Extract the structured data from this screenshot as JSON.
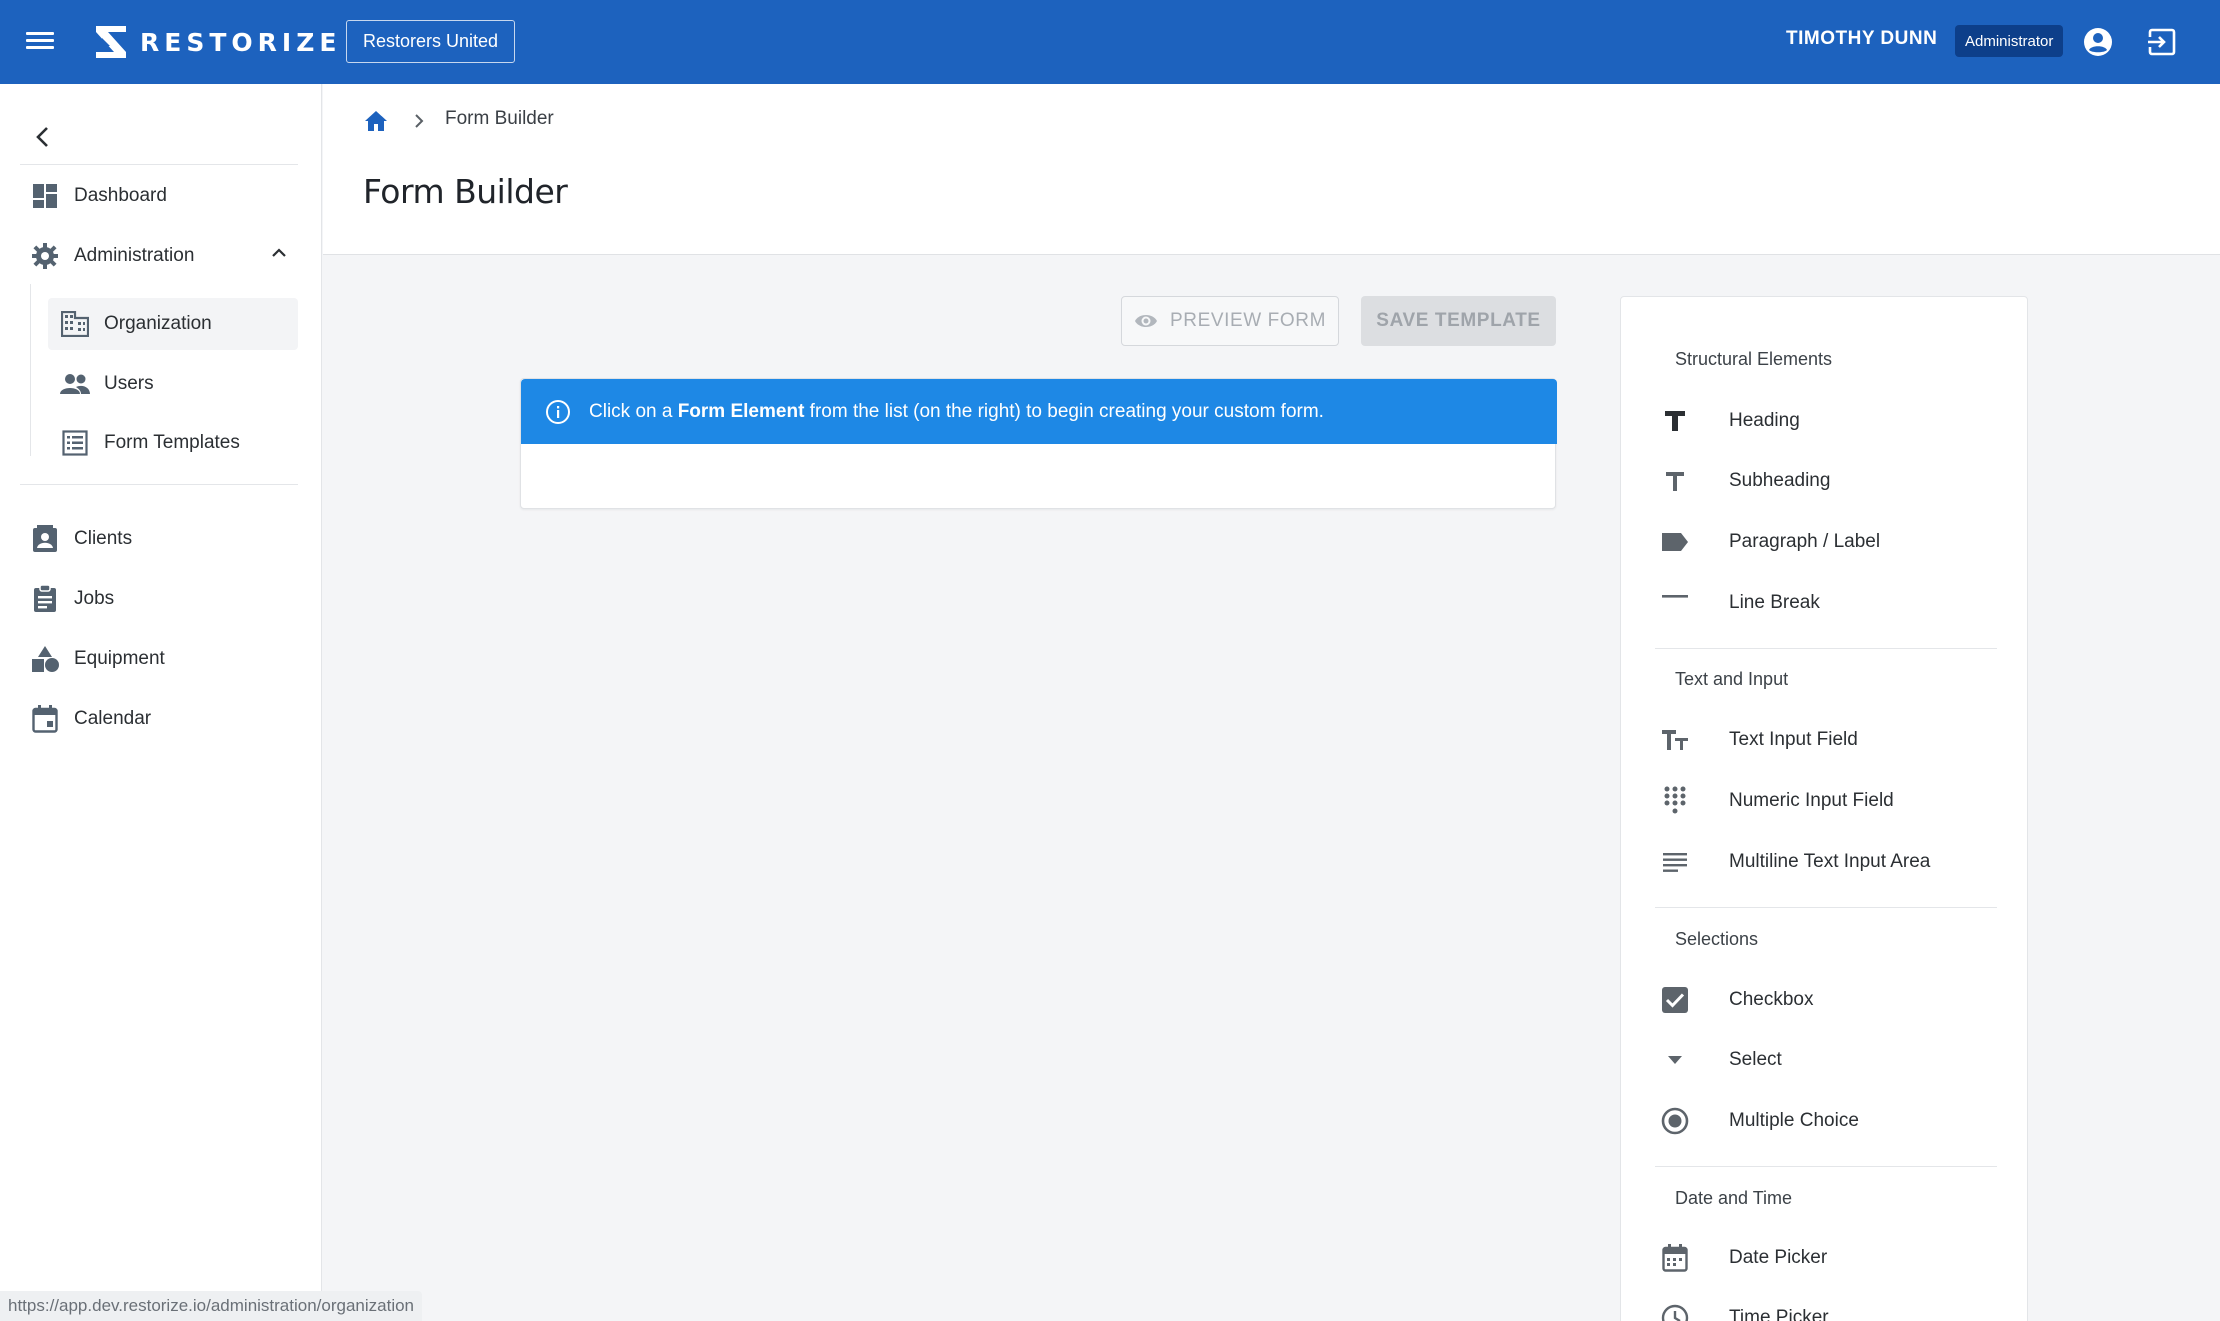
{
  "app": {
    "brand": "RESTORIZE",
    "org_button": "Restorers United"
  },
  "user": {
    "name": "TIMOTHY DUNN",
    "role": "Administrator"
  },
  "sidebar": {
    "items": [
      {
        "label": "Dashboard",
        "icon": "dashboard-icon"
      },
      {
        "label": "Administration",
        "icon": "gear-icon"
      },
      {
        "label": "Organization",
        "icon": "building-icon"
      },
      {
        "label": "Users",
        "icon": "users-icon"
      },
      {
        "label": "Form Templates",
        "icon": "form-templates-icon"
      },
      {
        "label": "Clients",
        "icon": "contact-card-icon"
      },
      {
        "label": "Jobs",
        "icon": "clipboard-icon"
      },
      {
        "label": "Equipment",
        "icon": "shapes-icon"
      },
      {
        "label": "Calendar",
        "icon": "calendar-icon"
      }
    ]
  },
  "breadcrumb": {
    "current": "Form Builder"
  },
  "page": {
    "title": "Form Builder"
  },
  "actions": {
    "preview": "PREVIEW FORM",
    "save": "SAVE TEMPLATE"
  },
  "banner": {
    "prefix": "Click on a ",
    "bold": "Form Element",
    "suffix": " from the list (on the right) to begin creating your custom form."
  },
  "palette": {
    "sections": [
      {
        "title": "Structural Elements",
        "items": [
          "Heading",
          "Subheading",
          "Paragraph / Label",
          "Line Break"
        ]
      },
      {
        "title": "Text and Input",
        "items": [
          "Text Input Field",
          "Numeric Input Field",
          "Multiline Text Input Area"
        ]
      },
      {
        "title": "Selections",
        "items": [
          "Checkbox",
          "Select",
          "Multiple Choice"
        ]
      },
      {
        "title": "Date and Time",
        "items": [
          "Date Picker",
          "Time Picker"
        ]
      }
    ]
  },
  "status_url": "https://app.dev.restorize.io/administration/organization",
  "colors": {
    "topbar": "#1d62be",
    "banner": "#1e88e5",
    "badge": "#0d3f8a",
    "icon_gray": "#546270"
  }
}
